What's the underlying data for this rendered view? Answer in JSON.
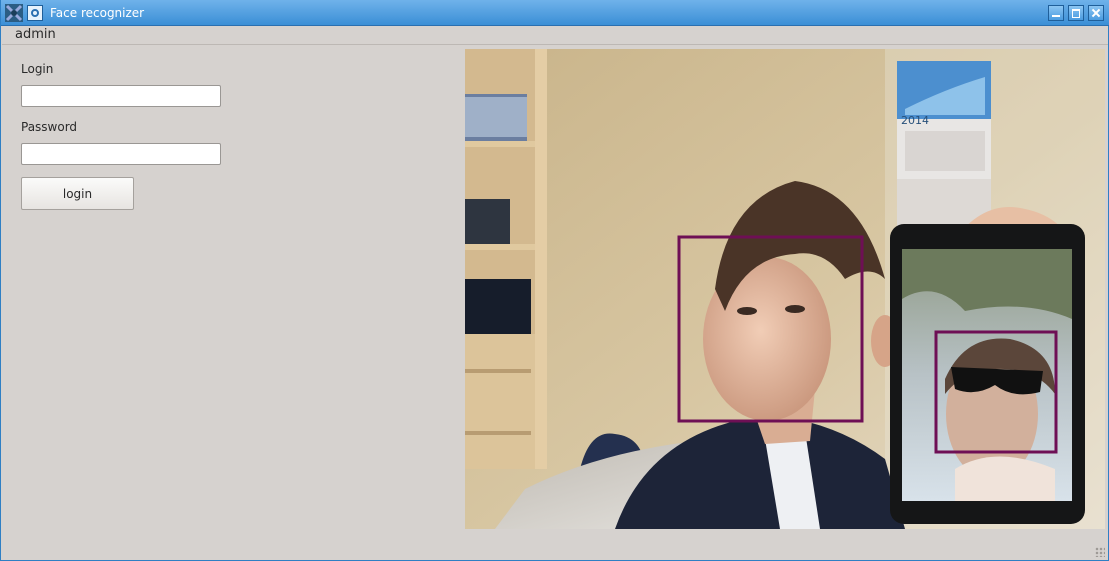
{
  "window": {
    "title": "Face recognizer"
  },
  "menu": {
    "items": [
      "admin"
    ]
  },
  "login_form": {
    "login_label": "Login",
    "login_value": "",
    "password_label": "Password",
    "password_value": "",
    "login_button": "login"
  },
  "camera": {
    "calendar_year": "2014",
    "detections": 2,
    "detection_color": "#6e0f55"
  },
  "colors": {
    "titlebar": "#3b8fd6",
    "window_bg": "#d6d2cf"
  }
}
